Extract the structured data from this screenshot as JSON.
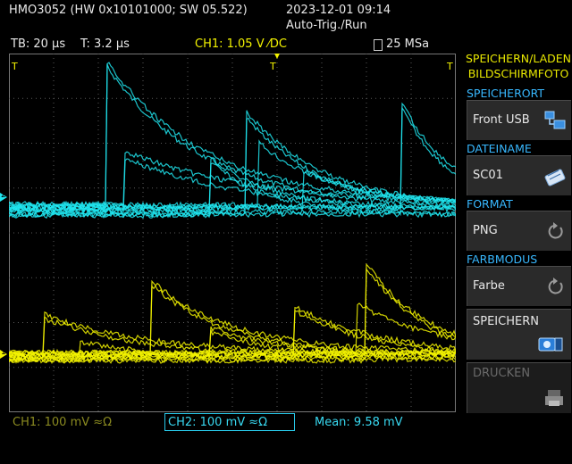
{
  "header": {
    "device": "HMO3052 (HW 0x10101000; SW 05.522)",
    "datetime": "2023-12-01 09:14",
    "trigger_mode": "Auto-Trig./Run"
  },
  "status": {
    "timebase": "TB: 20 µs",
    "trigger_time": "T: 3.2 µs",
    "trigger_info": "CH1: 1.05 V ⁄DC",
    "sample_rate": "25 MSa"
  },
  "sidebar": {
    "title_line1": "SPEICHERN/LADEN",
    "title_line2": "BILDSCHIRMFOTO",
    "sections": [
      {
        "heading": "SPEICHERORT",
        "value": "Front USB",
        "icon": "usb-folder-icon"
      },
      {
        "heading": "DATEINAME",
        "value": "SC01",
        "icon": "keyboard-edit-icon"
      },
      {
        "heading": "FORMAT",
        "value": "PNG",
        "icon": "cycle-arrow-icon"
      },
      {
        "heading": "FARBMODUS",
        "value": "Farbe",
        "icon": "cycle-arrow-icon"
      }
    ],
    "save_label": "SPEICHERN",
    "print_label": "DRUCKEN"
  },
  "footer": {
    "ch1_scale": "CH1: 100 mV ≈Ω",
    "ch2_scale": "CH2: 100 mV ≈Ω",
    "measurement": "Mean: 9.58 mV"
  },
  "markers": {
    "ch2_level": "2",
    "ch1_level": "1",
    "trigger_marker": "T"
  },
  "colors": {
    "ch1": "#f5f500",
    "ch2": "#20e6f0",
    "grid": "#555555",
    "heading": "#38b8ff",
    "title": "#e8e800"
  }
}
